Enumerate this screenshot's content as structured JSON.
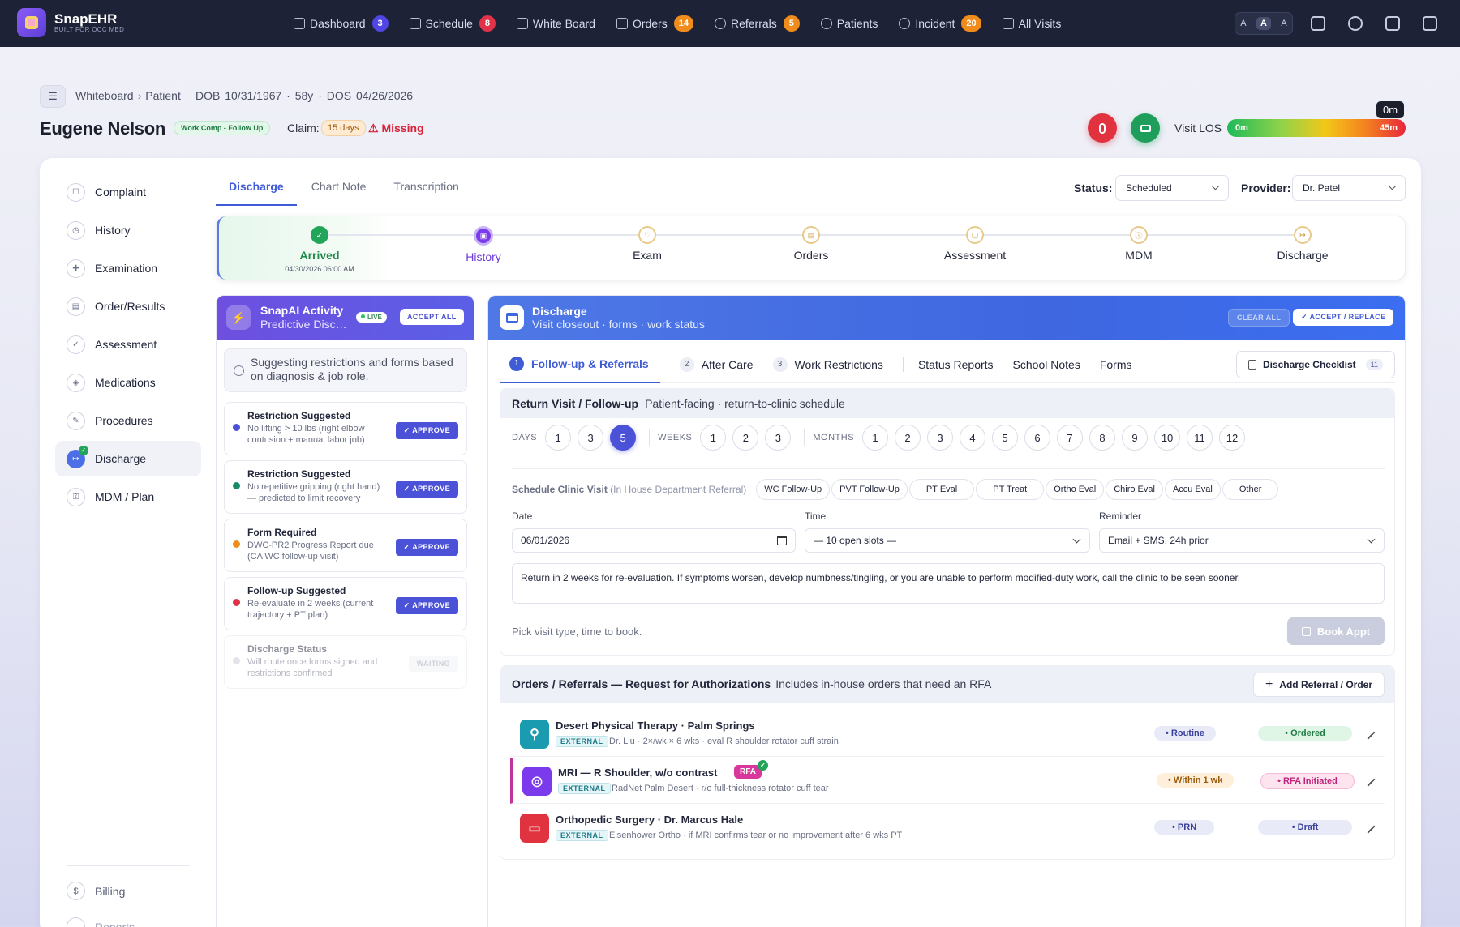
{
  "app": {
    "name": "SnapEHR",
    "tagline": "BUILT FOR OCC MED"
  },
  "nav": [
    {
      "label": "Dashboard",
      "badge": "3",
      "badge_color": "#4f46e5"
    },
    {
      "label": "Schedule",
      "badge": "8",
      "badge_color": "#e0334a"
    },
    {
      "label": "White Board",
      "badge": ""
    },
    {
      "label": "Orders",
      "badge": "14",
      "badge_color": "#f08c1b"
    },
    {
      "label": "Referrals",
      "badge": "5",
      "badge_color": "#f08c1b"
    },
    {
      "label": "Patients",
      "badge": ""
    },
    {
      "label": "Incident",
      "badge": "20",
      "badge_color": "#f08c1b"
    },
    {
      "label": "All Visits",
      "badge": ""
    }
  ],
  "font_sizes": [
    "A",
    "A",
    "A"
  ],
  "breadcrumb": {
    "items": [
      "Whiteboard",
      "Patient"
    ],
    "sep": "›",
    "info": "DOB 10/31/1967 · 58y · DOS 04/26/2026"
  },
  "patient": {
    "name": "Eugene Nelson",
    "visit_type": "Work Comp - Follow Up",
    "claim_label": "Claim:",
    "claim_days": "15 days",
    "missing": "⚠ Missing"
  },
  "los": {
    "label": "Visit LOS",
    "start": "0m",
    "end": "45m",
    "tooltip": "0m"
  },
  "sidebar": {
    "items": [
      {
        "label": "Complaint",
        "icon": "☐"
      },
      {
        "label": "History",
        "icon": "◷"
      },
      {
        "label": "Examination",
        "icon": "✚"
      },
      {
        "label": "Order/Results",
        "icon": "▤"
      },
      {
        "label": "Assessment",
        "icon": "✓"
      },
      {
        "label": "Medications",
        "icon": "◈"
      },
      {
        "label": "Procedures",
        "icon": "✎"
      },
      {
        "label": "Discharge",
        "icon": "↦"
      },
      {
        "label": "MDM / Plan",
        "icon": "⚿"
      }
    ],
    "billing": {
      "label": "Billing",
      "icon": "$"
    },
    "reports": {
      "label": "Reports"
    }
  },
  "tabs": [
    "Discharge",
    "Chart Note",
    "Transcription"
  ],
  "status": {
    "label": "Status:",
    "value": "Scheduled"
  },
  "provider": {
    "label": "Provider:",
    "value": "Dr. Patel"
  },
  "steps": [
    {
      "label": "Arrived",
      "sub": "04/30/2026 06:00 AM",
      "icon": "✓"
    },
    {
      "label": "History",
      "sub": "",
      "icon": "▣"
    },
    {
      "label": "Exam",
      "sub": "",
      "icon": "♡"
    },
    {
      "label": "Orders",
      "sub": "",
      "icon": "▤"
    },
    {
      "label": "Assessment",
      "sub": "",
      "icon": "▢"
    },
    {
      "label": "MDM",
      "sub": "",
      "icon": "ⓘ"
    },
    {
      "label": "Discharge",
      "sub": "",
      "icon": "↦"
    }
  ],
  "ai": {
    "title": "SnapAI Activity",
    "subtitle": "Predictive Discharge",
    "live": "LIVE",
    "accept_all": "ACCEPT ALL",
    "suggest_text": "Suggesting restrictions and forms based on diagnosis & job role.",
    "cards": [
      {
        "title": "Restriction Suggested",
        "desc": "No lifting > 10 lbs (right elbow contusion + manual labor job)",
        "dot": "#4c52d8",
        "action": "APPROVE"
      },
      {
        "title": "Restriction Suggested",
        "desc": "No repetitive gripping (right hand) — predicted to limit recovery",
        "dot": "#178a6a",
        "action": "APPROVE"
      },
      {
        "title": "Form Required",
        "desc": "DWC-PR2 Progress Report due (CA WC follow-up visit)",
        "dot": "#f08c1b",
        "action": "APPROVE"
      },
      {
        "title": "Follow-up Suggested",
        "desc": "Re-evaluate in 2 weeks (current trajectory + PT plan)",
        "dot": "#e0334a",
        "action": "APPROVE"
      },
      {
        "title": "Discharge Status",
        "desc": "Will route once forms signed and restrictions confirmed",
        "dot": "#c8cbd8",
        "action": "WAITING"
      }
    ]
  },
  "discharge": {
    "title": "Discharge",
    "subtitle": "Visit closeout · forms · work status",
    "clear_all": "CLEAR ALL",
    "accept_replace": "ACCEPT / REPLACE",
    "tabs": [
      {
        "n": "1",
        "label": "Follow-up & Referrals"
      },
      {
        "n": "2",
        "label": "After Care"
      },
      {
        "n": "3",
        "label": "Work Restrictions"
      },
      {
        "n": "",
        "label": "Status Reports"
      },
      {
        "n": "",
        "label": "School Notes"
      },
      {
        "n": "",
        "label": "Forms"
      }
    ],
    "checklist": {
      "label": "Discharge Checklist",
      "count": "11"
    },
    "return_visit": {
      "title": "Return Visit / Follow-up",
      "subtitle": "Patient-facing · return-to-clinic schedule",
      "days_label": "DAYS",
      "days": [
        "1",
        "3",
        "5"
      ],
      "days_selected": "5",
      "weeks_label": "WEEKS",
      "weeks": [
        "1",
        "2",
        "3"
      ],
      "months_label": "MONTHS",
      "months": [
        "1",
        "2",
        "3",
        "4",
        "5",
        "6",
        "7",
        "8",
        "9",
        "10",
        "11",
        "12"
      ],
      "schedule_label": "Schedule Clinic Visit",
      "schedule_sub": "(In House Department Referral)",
      "chips": [
        "WC Follow-Up",
        "PVT Follow-Up",
        "PT Eval",
        "PT Treat",
        "Ortho Eval",
        "Chiro Eval",
        "Accu Eval",
        "Other"
      ],
      "date_label": "Date",
      "date_value": "06/01/2026",
      "time_label": "Time",
      "time_value": "— 10 open slots —",
      "reminder_label": "Reminder",
      "reminder_value": "Email + SMS, 24h prior",
      "note": "Return in 2 weeks for re-evaluation. If symptoms worsen, develop numbness/tingling, or you are unable to perform modified-duty work, call the clinic to be seen sooner.",
      "hint": "Pick visit type, time to book.",
      "book": "Book Appt"
    },
    "orders": {
      "title": "Orders / Referrals — Request for Authorizations",
      "subtitle": "Includes in-house orders that need an RFA",
      "add": "Add Referral / Order",
      "rows": [
        {
          "title": "Desert Physical Therapy · Palm Springs",
          "tag": "EXTERNAL",
          "desc": "Dr. Liu · 2×/wk × 6 wks · eval R shoulder rotator cuff strain",
          "priority": "Routine",
          "status": "Ordered",
          "tile_color": "#1a9bb0",
          "icon": "⚲"
        },
        {
          "title": "MRI — R Shoulder, w/o contrast",
          "tag": "EXTERNAL",
          "desc": "RadNet Palm Desert · r/o full-thickness rotator cuff tear",
          "priority": "Within 1 wk",
          "status": "RFA Initiated",
          "rfa": "RFA",
          "tile_color": "#7c3aed",
          "icon": "◎"
        },
        {
          "title": "Orthopedic Surgery · Dr. Marcus Hale",
          "tag": "EXTERNAL",
          "desc": "Eisenhower Ortho · if MRI confirms tear or no improvement after 6 wks PT",
          "priority": "PRN",
          "status": "Draft",
          "tile_color": "#e0333f",
          "icon": "▭"
        }
      ]
    }
  }
}
